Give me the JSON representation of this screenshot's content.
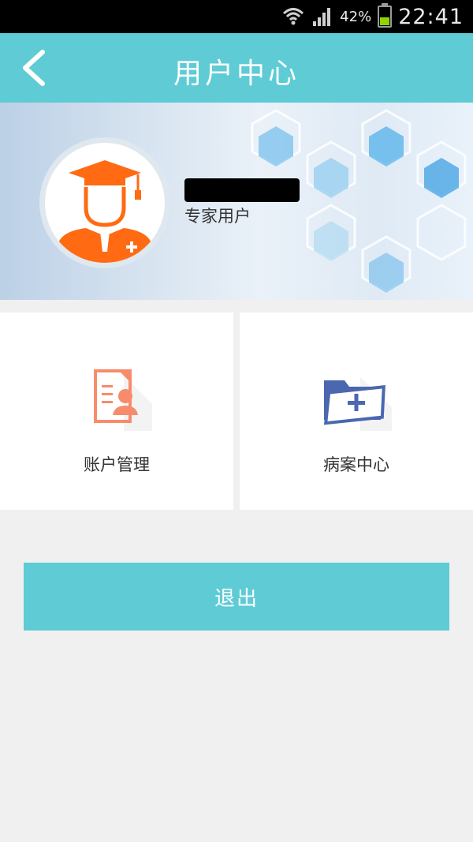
{
  "status_bar": {
    "battery_percent": "42%",
    "time": "22:41",
    "icons": [
      "wifi-icon",
      "signal-icon",
      "battery-icon"
    ],
    "battery_level": 0.42
  },
  "header": {
    "title": "用户中心",
    "back_icon": "chevron-left-icon"
  },
  "profile": {
    "role": "专家用户",
    "avatar_icon": "doctor-graduate-avatar-icon"
  },
  "tiles": [
    {
      "label": "账户管理",
      "icon": "account-document-icon"
    },
    {
      "label": "病案中心",
      "icon": "medical-folder-icon"
    }
  ],
  "logout": {
    "label": "退出"
  },
  "colors": {
    "primary": "#5ecbd5",
    "avatar_orange": "#ff6a13",
    "account_icon": "#f78c6c",
    "folder_icon": "#4a67b0",
    "background": "#f0f0f0"
  }
}
